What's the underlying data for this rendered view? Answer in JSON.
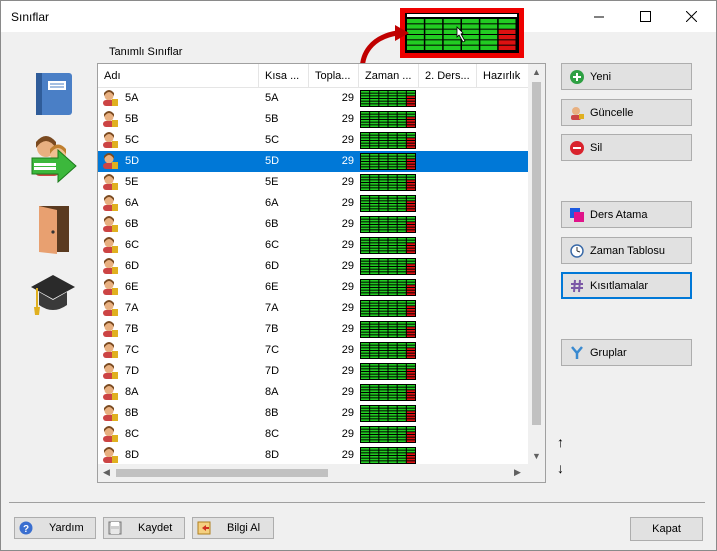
{
  "window": {
    "title": "Sınıflar",
    "minimize_icon": "minimize-icon",
    "maximize_icon": "maximize-icon",
    "close_icon": "close-icon"
  },
  "group_label": "Tanımlı Sınıflar",
  "left_icons": [
    "book-icon",
    "teachers-arrow-icon",
    "door-icon",
    "graduation-cap-icon"
  ],
  "grid": {
    "columns": [
      "Adı",
      "Kısa ...",
      "Topla...",
      "Zaman ...",
      "2. Ders...",
      "Hazırlık"
    ],
    "selected_row": "5D",
    "rows": [
      {
        "name": "5A",
        "short": "5A",
        "total": "29"
      },
      {
        "name": "5B",
        "short": "5B",
        "total": "29"
      },
      {
        "name": "5C",
        "short": "5C",
        "total": "29"
      },
      {
        "name": "5D",
        "short": "5D",
        "total": "29"
      },
      {
        "name": "5E",
        "short": "5E",
        "total": "29"
      },
      {
        "name": "6A",
        "short": "6A",
        "total": "29"
      },
      {
        "name": "6B",
        "short": "6B",
        "total": "29"
      },
      {
        "name": "6C",
        "short": "6C",
        "total": "29"
      },
      {
        "name": "6D",
        "short": "6D",
        "total": "29"
      },
      {
        "name": "6E",
        "short": "6E",
        "total": "29"
      },
      {
        "name": "7A",
        "short": "7A",
        "total": "29"
      },
      {
        "name": "7B",
        "short": "7B",
        "total": "29"
      },
      {
        "name": "7C",
        "short": "7C",
        "total": "29"
      },
      {
        "name": "7D",
        "short": "7D",
        "total": "29"
      },
      {
        "name": "8A",
        "short": "8A",
        "total": "29"
      },
      {
        "name": "8B",
        "short": "8B",
        "total": "29"
      },
      {
        "name": "8C",
        "short": "8C",
        "total": "29"
      },
      {
        "name": "8D",
        "short": "8D",
        "total": "29"
      }
    ]
  },
  "side_buttons": {
    "new": "Yeni",
    "update": "Güncelle",
    "delete": "Sil",
    "lesson_assign": "Ders Atama",
    "timetable": "Zaman Tablosu",
    "constraints": "Kısıtlamalar",
    "groups": "Gruplar"
  },
  "move_up": "↑",
  "move_down": "↓",
  "bottom": {
    "help": "Yardım",
    "save": "Kaydet",
    "info": "Bilgi Al",
    "close": "Kapat"
  },
  "colors": {
    "selection": "#0078d7",
    "available": "#22cc22",
    "unavailable": "#dd1111",
    "callout": "#e00000"
  }
}
